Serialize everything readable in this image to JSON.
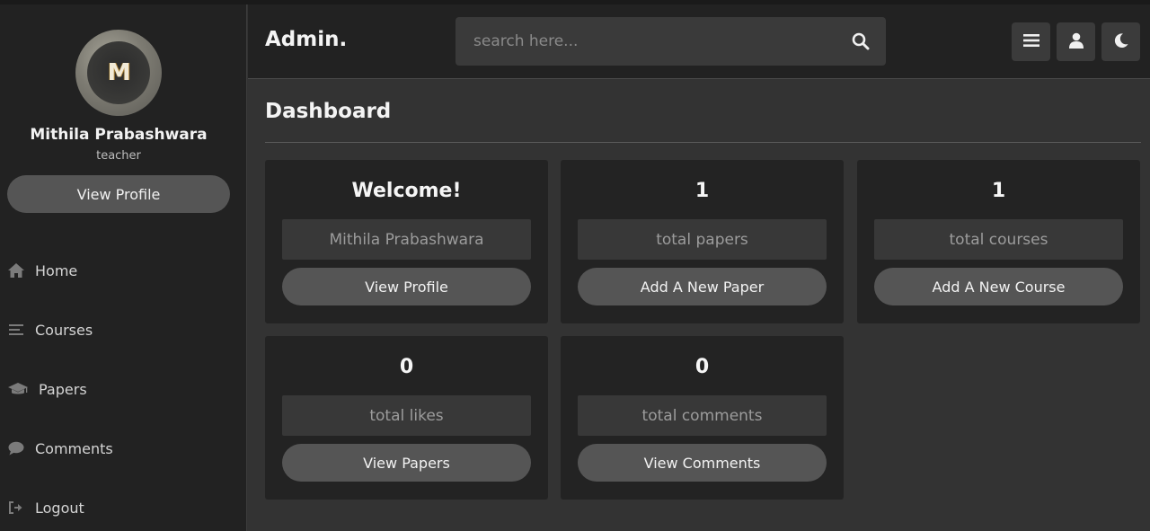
{
  "sidebar": {
    "profile": {
      "avatar_letter": "M",
      "name": "Mithila Prabashwara",
      "role": "teacher",
      "view_profile_label": "View Profile"
    },
    "items": [
      {
        "label": "Home",
        "icon": "home-icon"
      },
      {
        "label": "Courses",
        "icon": "list-icon"
      },
      {
        "label": "Papers",
        "icon": "graduation-cap-icon"
      },
      {
        "label": "Comments",
        "icon": "comment-icon"
      },
      {
        "label": "Logout",
        "icon": "logout-icon"
      }
    ]
  },
  "header": {
    "brand": "Admin.",
    "search": {
      "placeholder": "search here...",
      "value": ""
    },
    "buttons": [
      "menu-icon",
      "user-icon",
      "moon-icon"
    ]
  },
  "main": {
    "title": "Dashboard",
    "cards": [
      {
        "title": "Welcome!",
        "box": "Mithila Prabashwara",
        "button": "View Profile"
      },
      {
        "title": "1",
        "box": "total papers",
        "button": "Add A New Paper"
      },
      {
        "title": "1",
        "box": "total courses",
        "button": "Add A New Course"
      },
      {
        "title": "0",
        "box": "total likes",
        "button": "View Papers"
      },
      {
        "title": "0",
        "box": "total comments",
        "button": "View Comments"
      }
    ]
  },
  "colors": {
    "page_bg": "#333333",
    "panel_bg": "#222222",
    "card_bg": "#232323",
    "button_bg": "#555555",
    "field_bg": "#383838"
  }
}
